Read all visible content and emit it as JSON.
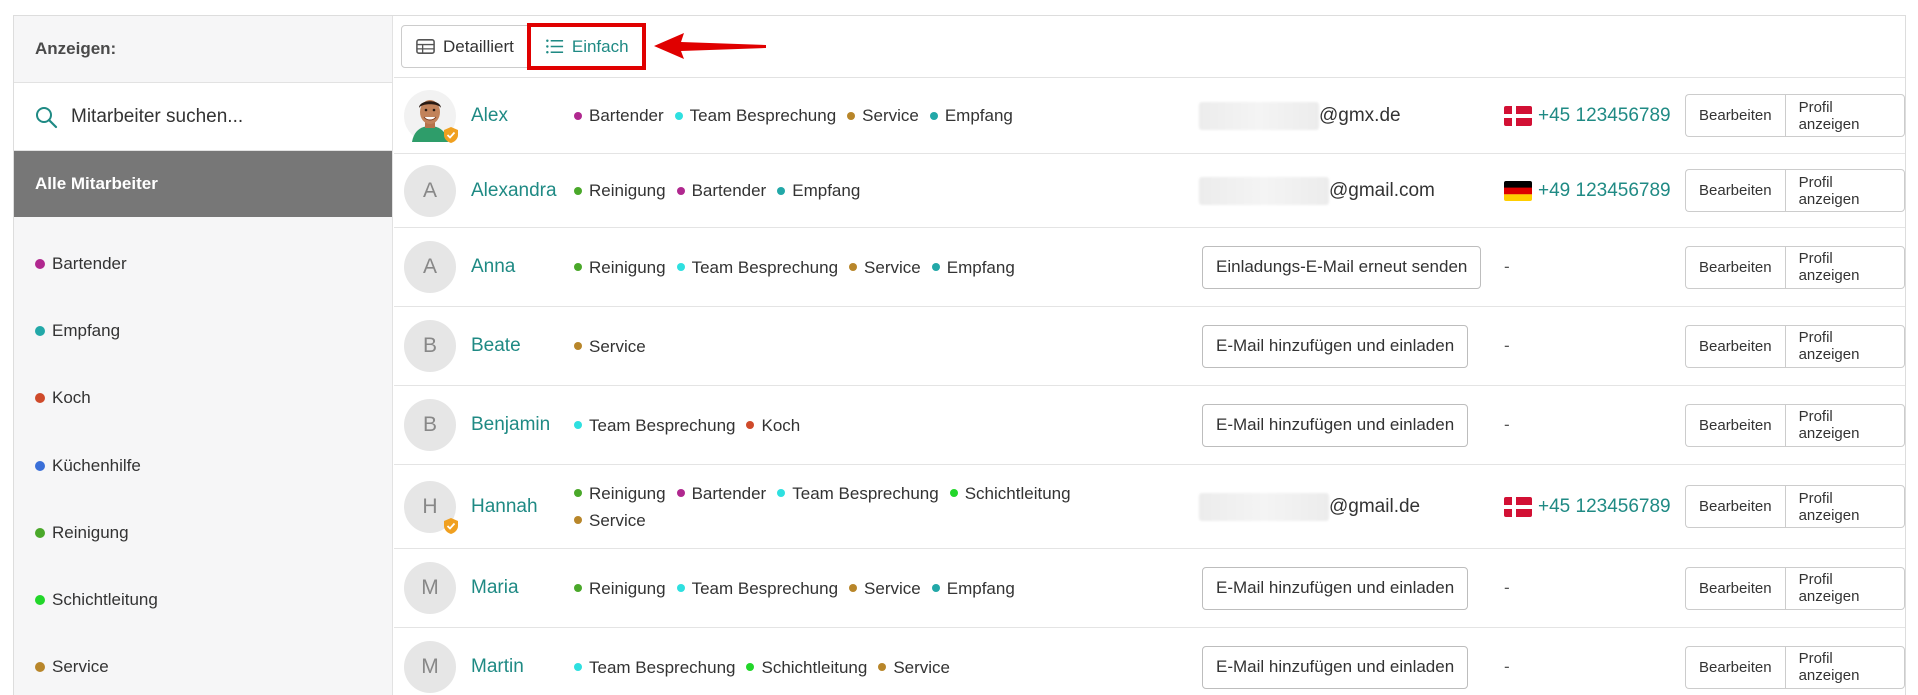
{
  "sidebar": {
    "header": "Anzeigen:",
    "search_placeholder": "Mitarbeiter suchen...",
    "all_label": "Alle Mitarbeiter",
    "items": [
      {
        "label": "Bartender",
        "color": "#b0288f"
      },
      {
        "label": "Empfang",
        "color": "#22a8a8"
      },
      {
        "label": "Koch",
        "color": "#cf4a2a"
      },
      {
        "label": "Küchenhilfe",
        "color": "#3a6fd8"
      },
      {
        "label": "Reinigung",
        "color": "#4aa82a"
      },
      {
        "label": "Schichtleitung",
        "color": "#22d62a"
      },
      {
        "label": "Service",
        "color": "#b8862a"
      }
    ]
  },
  "toolbar": {
    "detail_label": "Detailliert",
    "simple_label": "Einfach"
  },
  "actions": {
    "edit": "Bearbeiten",
    "profile": "Profil anzeigen"
  },
  "employees": [
    {
      "name": "Alex",
      "initial": "",
      "photo": true,
      "verified": true,
      "tags": [
        [
          "Bartender",
          "#b0288f"
        ],
        [
          "Team Besprechung",
          "#2ee0e0"
        ],
        [
          "Service",
          "#b8862a"
        ],
        [
          "Empfang",
          "#22a8a8"
        ]
      ],
      "email_suffix": "@gmx.de",
      "phone": "+45 123456789",
      "flag": "dk"
    },
    {
      "name": "Alexandra",
      "initial": "A",
      "verified": false,
      "tags": [
        [
          "Reinigung",
          "#4aa82a"
        ],
        [
          "Bartender",
          "#b0288f"
        ],
        [
          "Empfang",
          "#22a8a8"
        ]
      ],
      "email_suffix": "@gmail.com",
      "phone": "+49 123456789",
      "flag": "de"
    },
    {
      "name": "Anna",
      "initial": "A",
      "verified": false,
      "tags": [
        [
          "Reinigung",
          "#4aa82a"
        ],
        [
          "Team Besprechung",
          "#2ee0e0"
        ],
        [
          "Service",
          "#b8862a"
        ],
        [
          "Empfang",
          "#22a8a8"
        ]
      ],
      "invite": "Einladungs-E-Mail erneut senden",
      "phone_placeholder": "-"
    },
    {
      "name": "Beate",
      "initial": "B",
      "verified": false,
      "tags": [
        [
          "Service",
          "#b8862a"
        ]
      ],
      "invite": "E-Mail hinzufügen und einladen",
      "phone_placeholder": "-"
    },
    {
      "name": "Benjamin",
      "initial": "B",
      "verified": false,
      "tags": [
        [
          "Team Besprechung",
          "#2ee0e0"
        ],
        [
          "Koch",
          "#cf4a2a"
        ]
      ],
      "invite": "E-Mail hinzufügen und einladen",
      "phone_placeholder": "-"
    },
    {
      "name": "Hannah",
      "initial": "H",
      "verified": true,
      "tags": [
        [
          "Reinigung",
          "#4aa82a"
        ],
        [
          "Bartender",
          "#b0288f"
        ],
        [
          "Team Besprechung",
          "#2ee0e0"
        ],
        [
          "Schichtleitung",
          "#22d62a"
        ],
        [
          "Service",
          "#b8862a"
        ]
      ],
      "email_suffix": "@gmail.de",
      "phone": "+45 123456789",
      "flag": "dk"
    },
    {
      "name": "Maria",
      "initial": "M",
      "verified": false,
      "tags": [
        [
          "Reinigung",
          "#4aa82a"
        ],
        [
          "Team Besprechung",
          "#2ee0e0"
        ],
        [
          "Service",
          "#b8862a"
        ],
        [
          "Empfang",
          "#22a8a8"
        ]
      ],
      "invite": "E-Mail hinzufügen und einladen",
      "phone_placeholder": "-"
    },
    {
      "name": "Martin",
      "initial": "M",
      "verified": false,
      "tags": [
        [
          "Team Besprechung",
          "#2ee0e0"
        ],
        [
          "Schichtleitung",
          "#22d62a"
        ],
        [
          "Service",
          "#b8862a"
        ]
      ],
      "invite": "E-Mail hinzufügen und einladen",
      "phone_placeholder": "-"
    }
  ]
}
